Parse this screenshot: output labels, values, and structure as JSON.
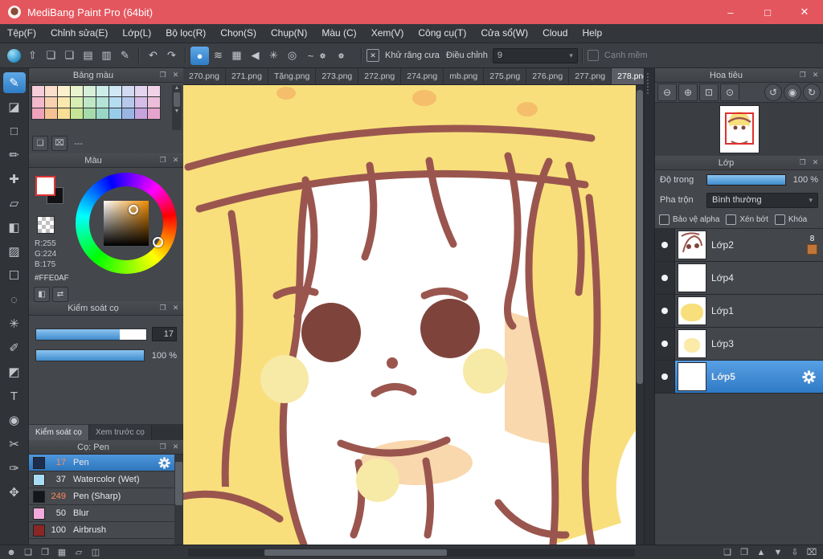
{
  "window": {
    "title": "MediBang Paint Pro (64bit)",
    "controls": {
      "minimize": "–",
      "maximize": "□",
      "close": "✕"
    }
  },
  "menubar": {
    "items": [
      "Tệp(F)",
      "Chỉnh sửa(E)",
      "Lớp(L)",
      "Bộ lọc(R)",
      "Chọn(S)",
      "Chụp(N)",
      "Màu (C)",
      "Xem(V)",
      "Công cụ(T)",
      "Cửa sổ(W)",
      "Cloud",
      "Help"
    ]
  },
  "toolbar": {
    "antialias_label": "Khử răng cưa",
    "adjust_label": "Điều chỉnh",
    "adjust_value": "9",
    "soft_edge_label": "Cạnh mềm"
  },
  "icons": {
    "undo": "↶",
    "redo": "↷",
    "upload": "⇧",
    "comment": "❏",
    "chat": "❑",
    "document": "▤",
    "pages": "▥",
    "edit_doc": "✎",
    "ball": "●",
    "lines": "≋",
    "grid": "▦",
    "triangle": "◀",
    "asterisk": "✳",
    "target": "◎",
    "curve": "~",
    "antialias": "✕",
    "caret_down": "▾",
    "float": "❐",
    "close": "✕",
    "scroll_up": "▲",
    "scroll_down": "▼",
    "zoom_out": "⊖",
    "zoom_in": "⊕",
    "fit_screen": "⊡",
    "actual_size": "⊙",
    "rotate_left": "↺",
    "reset_view": "◉",
    "rotate_right": "↻",
    "new_item": "❏",
    "trash": "⌧",
    "palette_mode": "◧",
    "swap_colors": "⇄",
    "account": "☻",
    "new_canvas": "❏",
    "duplicate": "❐",
    "grid_view": "▦",
    "folder": "▱",
    "windows": "◫",
    "layer_new": "❏",
    "layer_duplicate": "❐",
    "layer_up": "▲",
    "layer_down": "▼",
    "layer_merge": "⇩",
    "layer_delete": "⌧"
  },
  "tools": {
    "glyphs": [
      "✎",
      "◪",
      "□",
      "✏",
      "✚",
      "▱",
      "◧",
      "▨",
      "☐",
      "◌",
      "✳",
      "✐",
      "◩",
      "T",
      "◉",
      "✂",
      "✑",
      "✥"
    ]
  },
  "tabs": {
    "items": [
      {
        "label": "270.png"
      },
      {
        "label": "271.png"
      },
      {
        "label": "Tặng.png"
      },
      {
        "label": "273.png"
      },
      {
        "label": "272.png"
      },
      {
        "label": "274.png"
      },
      {
        "label": "mb.png"
      },
      {
        "label": "275.png"
      },
      {
        "label": "276.png"
      },
      {
        "label": "277.png"
      },
      {
        "label": "278.png",
        "active": true
      }
    ]
  },
  "panels": {
    "palette": {
      "title": "Bảng màu",
      "footer_label": "---",
      "colors": [
        "#f6cdd9",
        "#fbdfca",
        "#fdf0cd",
        "#e9f4cf",
        "#d7efd9",
        "#cdeee8",
        "#d0e8f4",
        "#d2d9f2",
        "#e4d4f0",
        "#f2d2e7",
        "#f3b9cb",
        "#f8d2ae",
        "#fbe8ae",
        "#d8edb2",
        "#bfe7c6",
        "#b4e3d8",
        "#b6dcf0",
        "#b8c8ec",
        "#d6bde8",
        "#ecbeda",
        "#efa3ba",
        "#f5c392",
        "#f9de94",
        "#c6e494",
        "#a6dcac",
        "#9ad6c6",
        "#98cdea",
        "#9ab4e4",
        "#c7a4de",
        "#e4a4cc"
      ]
    },
    "color": {
      "title": "Màu",
      "r": "R:255",
      "g": "G:224",
      "b": "B:175",
      "hex": "#FFE0AF",
      "current": "#FFE0AF"
    },
    "brush_control": {
      "title": "Kiểm soát cọ",
      "size_value": "17",
      "opacity_value": "100 %",
      "tabs": [
        {
          "label": "Kiểm soát cọ",
          "active": true
        },
        {
          "label": "Xem trước cọ"
        }
      ]
    },
    "brushes": {
      "title": "Cọ: Pen",
      "items": [
        {
          "size": "17",
          "name": "Pen",
          "swatch": "#1e2c4e",
          "size_color": "#ff8a5c",
          "selected": true
        },
        {
          "size": "37",
          "name": "Watercolor (Wet)",
          "swatch": "#a8dcf2",
          "size_color": "#e9ebee"
        },
        {
          "size": "249",
          "name": "Pen (Sharp)",
          "swatch": "#15161a",
          "size_color": "#ff8a5c"
        },
        {
          "size": "50",
          "name": "Blur",
          "swatch": "#f2aadd",
          "size_color": "#e9ebee"
        },
        {
          "size": "100",
          "name": "Airbrush",
          "swatch": "#8a2724",
          "size_color": "#e9ebee"
        }
      ]
    },
    "navigator": {
      "title": "Hoa tiêu"
    },
    "layers": {
      "title": "Lớp",
      "opacity_label": "Độ trong",
      "opacity_value": "100 %",
      "blend_label": "Pha trộn",
      "blend_value": "Bình thường",
      "checkboxes": [
        "Bảo vệ alpha",
        "Xén bớt",
        "Khóa"
      ],
      "items": [
        {
          "name": "Lớp2",
          "badge": "8"
        },
        {
          "name": "Lớp4"
        },
        {
          "name": "Lớp1"
        },
        {
          "name": "Lớp3"
        },
        {
          "name": "Lớp5",
          "selected": true
        }
      ]
    }
  },
  "colors": {
    "titlebar": "#e4565e",
    "accent": "#3f8ccd",
    "selection_blue": "#3f86c9",
    "current_color": "#FFE0AF"
  }
}
